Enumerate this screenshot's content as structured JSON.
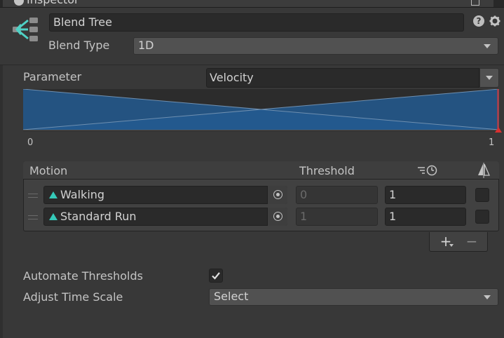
{
  "tab": {
    "title": "Inspector"
  },
  "header": {
    "name_value": "Blend Tree",
    "help_label": "?",
    "blend_type_label": "Blend Type",
    "blend_type_value": "1D"
  },
  "parameter": {
    "label": "Parameter",
    "value": "Velocity",
    "range_min": "0",
    "range_max": "1"
  },
  "motion_list": {
    "headers": {
      "motion": "Motion",
      "threshold": "Threshold"
    },
    "rows": [
      {
        "motion": "Walking",
        "threshold": "0",
        "time_scale": "1",
        "mirror": false
      },
      {
        "motion": "Standard Run",
        "threshold": "1",
        "time_scale": "1",
        "mirror": false
      }
    ],
    "add_label": "+",
    "remove_label": "−"
  },
  "settings": {
    "automate_label": "Automate Thresholds",
    "automate_checked": true,
    "adjust_label": "Adjust Time Scale",
    "adjust_value": "Select"
  },
  "colors": {
    "graph_fill": "#235a91",
    "clip_icon": "#35c9b8",
    "icon_teal": "#4fd1c5"
  }
}
